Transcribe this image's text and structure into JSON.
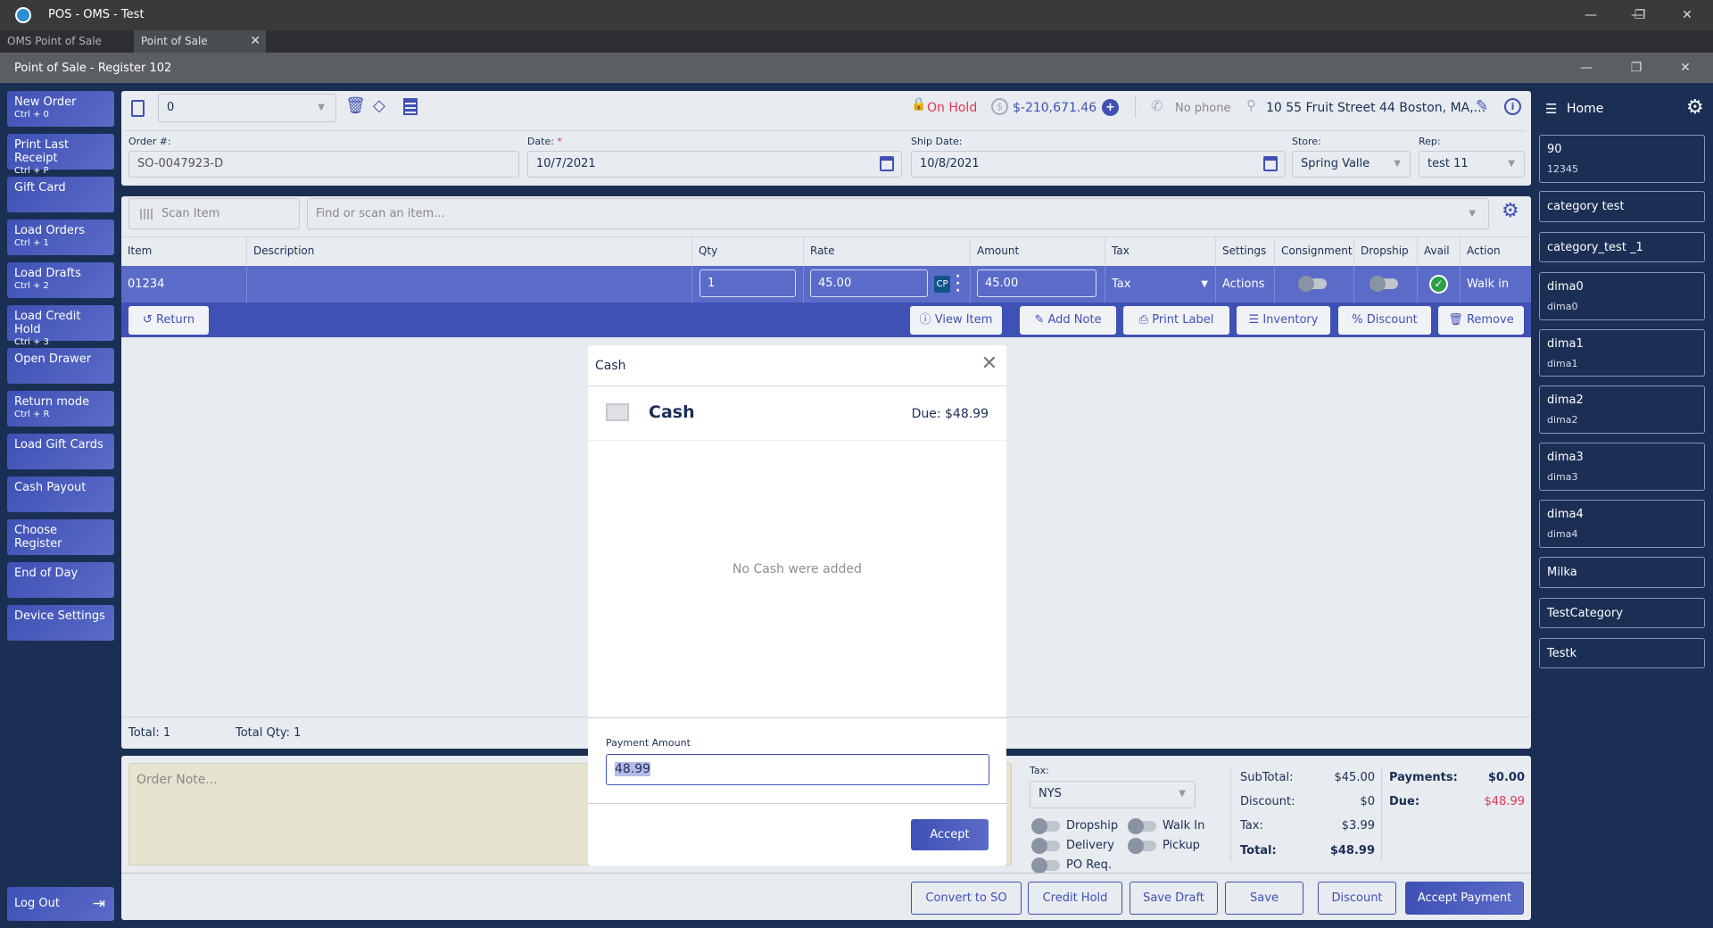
{
  "window": {
    "title": "POS - OMS - Test",
    "register_title": "Point of Sale - Register 102"
  },
  "tabs": [
    {
      "label": "OMS Point of Sale"
    },
    {
      "label": "Point of Sale"
    }
  ],
  "left_nav": [
    {
      "label": "New Order",
      "shortcut": "Ctrl + 0"
    },
    {
      "label": "Print Last Receipt",
      "shortcut": "Ctrl + P"
    },
    {
      "label": "Gift Card",
      "shortcut": ""
    },
    {
      "label": "Load Orders",
      "shortcut": "Ctrl + 1"
    },
    {
      "label": "Load Drafts",
      "shortcut": "Ctrl + 2"
    },
    {
      "label": "Load Credit Hold",
      "shortcut": "Ctrl + 3"
    },
    {
      "label": "Open Drawer",
      "shortcut": ""
    },
    {
      "label": "Return mode",
      "shortcut": "Ctrl + R"
    },
    {
      "label": "Load Gift Cards",
      "shortcut": ""
    },
    {
      "label": "Cash Payout",
      "shortcut": ""
    },
    {
      "label": "Choose Register",
      "shortcut": ""
    },
    {
      "label": "End of Day",
      "shortcut": ""
    },
    {
      "label": "Device Settings",
      "shortcut": ""
    }
  ],
  "logout": "Log Out",
  "header": {
    "customer_value": "0",
    "status": "On Hold",
    "balance": "$-210,671.46",
    "phone": "No phone",
    "address": "10 55 Fruit Street 44 Boston, MA,..."
  },
  "form": {
    "order_label": "Order #:",
    "order_value": "SO-0047923-D",
    "date_label": "Date:",
    "date_required": "*",
    "date_value": "10/7/2021",
    "ship_label": "Ship Date:",
    "ship_value": "10/8/2021",
    "store_label": "Store:",
    "store_value": "Spring Valle",
    "rep_label": "Rep:",
    "rep_value": "test 11"
  },
  "search": {
    "scan_placeholder": "Scan Item",
    "find_placeholder": "Find or scan an item..."
  },
  "table": {
    "headers": [
      "Item",
      "Description",
      "Qty",
      "Rate",
      "Amount",
      "Tax",
      "Settings",
      "Consignment",
      "Dropship",
      "Avail",
      "Action"
    ],
    "row": {
      "item": "01234",
      "description": "",
      "qty": "1",
      "rate": "45.00",
      "cp": "CP",
      "amount": "45.00",
      "tax": "Tax",
      "settings": "Actions",
      "action": "Walk in"
    }
  },
  "row_actions": {
    "return": "Return",
    "view": "View Item",
    "note": "Add Note",
    "print": "Print Label",
    "inventory": "Inventory",
    "discount": "Discount",
    "remove": "Remove"
  },
  "totals": {
    "total_label": "Total:",
    "total_value": "1",
    "qty_label": "Total Qty:",
    "qty_value": "1"
  },
  "bottom": {
    "note_placeholder": "Order Note...",
    "tax_label": "Tax:",
    "tax_value": "NYS",
    "toggles": [
      "Dropship",
      "Walk In",
      "Delivery",
      "Pickup",
      "PO Req."
    ],
    "subtotal_label": "SubTotal:",
    "subtotal": "$45.00",
    "discount_label": "Discount:",
    "discount": "$0",
    "tax_amt_label": "Tax:",
    "tax_amt": "$3.99",
    "total_label": "Total:",
    "total": "$48.99",
    "payments_label": "Payments:",
    "payments": "$0.00",
    "due_label": "Due:",
    "due": "$48.99",
    "due_color": "#e0365a"
  },
  "footer": [
    "Convert to SO",
    "Credit Hold",
    "Save Draft",
    "Save",
    "Discount",
    "Accept Payment"
  ],
  "right": {
    "home": "Home",
    "items": [
      {
        "label": "90",
        "sub": "12345"
      },
      {
        "label": "category test",
        "sub": ""
      },
      {
        "label": "category_test _1",
        "sub": ""
      },
      {
        "label": "dima0",
        "sub": "dima0"
      },
      {
        "label": "dima1",
        "sub": "dima1"
      },
      {
        "label": "dima2",
        "sub": "dima2"
      },
      {
        "label": "dima3",
        "sub": "dima3"
      },
      {
        "label": "dima4",
        "sub": "dima4"
      },
      {
        "label": "Milka",
        "sub": ""
      },
      {
        "label": "TestCategory",
        "sub": ""
      },
      {
        "label": "Testk",
        "sub": ""
      }
    ]
  },
  "modal": {
    "title": "Cash",
    "method": "Cash",
    "due": "Due: $48.99",
    "empty": "No Cash were added",
    "amount_label": "Payment Amount",
    "amount_value": "48.99",
    "accept": "Accept"
  },
  "colors": {
    "primary": "#3f51b5",
    "navy": "#1b2f55",
    "hold": "#e0365a"
  }
}
